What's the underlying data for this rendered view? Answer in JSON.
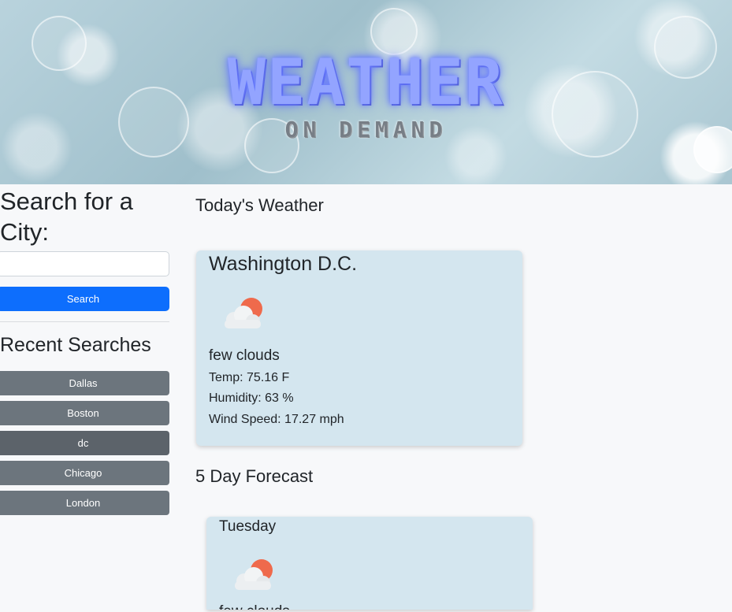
{
  "banner": {
    "title": "WEATHER",
    "subtitle": "ON DEMAND"
  },
  "sidebar": {
    "heading": "Search for a City:",
    "search_input": {
      "value": "",
      "placeholder": ""
    },
    "search_button_label": "Search",
    "recent_heading": "Recent Searches",
    "recent_items": [
      {
        "label": "Dallas"
      },
      {
        "label": "Boston"
      },
      {
        "label": "dc"
      },
      {
        "label": "Chicago"
      },
      {
        "label": "London"
      }
    ]
  },
  "today": {
    "heading": "Today's Weather",
    "city": "Washington D.C.",
    "icon": "few-clouds-day-icon",
    "description": "few clouds",
    "temp": "Temp: 75.16 F",
    "humidity": "Humidity: 63 %",
    "wind": "Wind Speed: 17.27 mph"
  },
  "forecast": {
    "heading": "5 Day Forecast",
    "days": [
      {
        "day": "Tuesday",
        "icon": "few-clouds-day-icon",
        "description": "few clouds"
      }
    ]
  },
  "colors": {
    "primary_button": "#0d6efd",
    "secondary_button": "#6c757d",
    "card_background": "#d4e6ef",
    "logo_title": "#93a4ff",
    "sun": "#ef6a4c"
  }
}
